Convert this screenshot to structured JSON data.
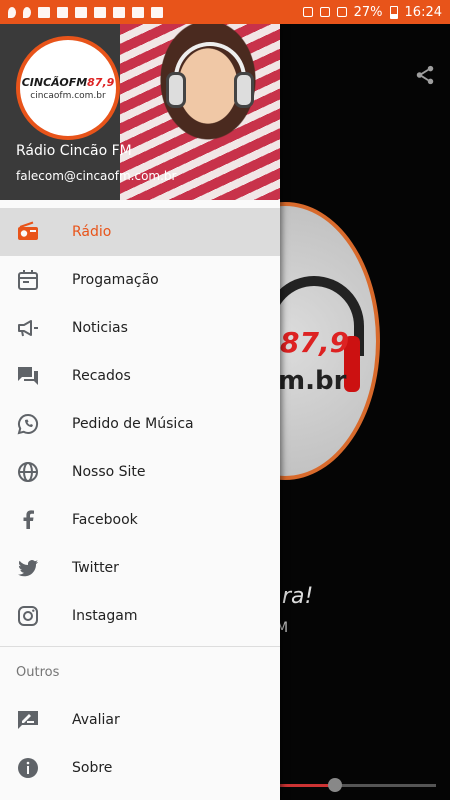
{
  "status_bar": {
    "battery": "27%",
    "time": "16:24"
  },
  "drawer_header": {
    "logo_brand": "CINCÃO",
    "logo_fm": "FM",
    "logo_freq": "87,9",
    "logo_url": "cincaofm.com.br",
    "station_name": "Rádio Cincão FM",
    "email": "falecom@cincaofm.com.br"
  },
  "menu": {
    "items": [
      {
        "label": "Rádio",
        "icon": "radio-icon",
        "active": true
      },
      {
        "label": "Progamação",
        "icon": "calendar-icon",
        "active": false
      },
      {
        "label": "Noticias",
        "icon": "megaphone-icon",
        "active": false
      },
      {
        "label": "Recados",
        "icon": "chat-bubbles-icon",
        "active": false
      },
      {
        "label": "Pedido de Música",
        "icon": "whatsapp-icon",
        "active": false
      },
      {
        "label": "Nosso Site",
        "icon": "globe-icon",
        "active": false
      },
      {
        "label": "Facebook",
        "icon": "facebook-icon",
        "active": false
      },
      {
        "label": "Twitter",
        "icon": "twitter-icon",
        "active": false
      },
      {
        "label": "Instagam",
        "icon": "instagram-icon",
        "active": false
      }
    ],
    "section_label": "Outros",
    "other_items": [
      {
        "label": "Avaliar",
        "icon": "rate-icon"
      },
      {
        "label": "Sobre",
        "icon": "info-icon"
      }
    ]
  },
  "player": {
    "logo_freq": "87,9",
    "logo_url": "m.br",
    "tagline_partial": "ra!",
    "sub_partial": "M",
    "seek_progress": 0.35
  },
  "colors": {
    "accent": "#e8541a",
    "icon_grey": "#5f6368",
    "active_bg": "#dcdcdc"
  }
}
